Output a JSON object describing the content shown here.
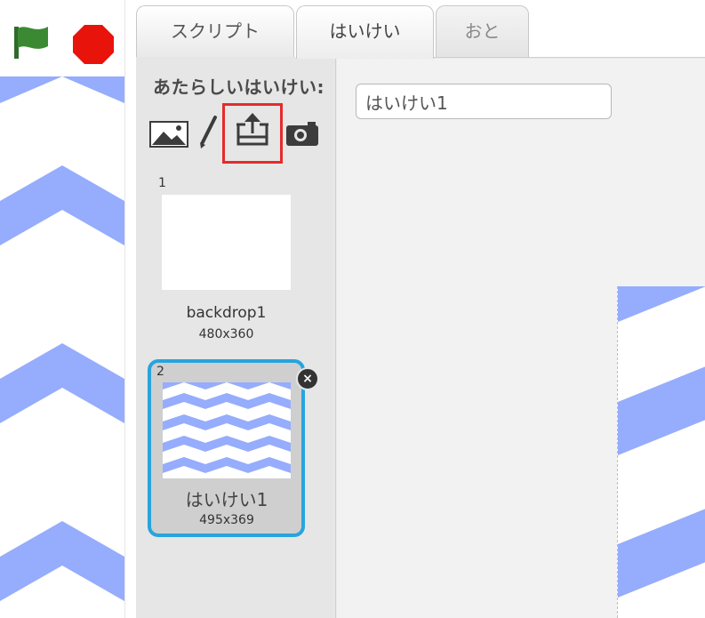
{
  "tabs": {
    "scripts": "スクリプト",
    "backdrops": "はいけい",
    "sounds": "おと"
  },
  "new_backdrop": {
    "label": "あたらしいはいけい:"
  },
  "name_field": {
    "value": "はいけい1"
  },
  "backdrops": [
    {
      "index": "1",
      "name": "backdrop1",
      "size": "480x360"
    },
    {
      "index": "2",
      "name": "はいけい1",
      "size": "495x369"
    }
  ],
  "icons": {
    "green_flag": "green-flag-icon",
    "stop": "stop-icon",
    "paint_picture": "image-icon",
    "paint_brush": "paintbrush-icon",
    "upload": "upload-icon",
    "camera": "camera-icon",
    "delete": "close-icon"
  },
  "colors": {
    "flag_green": "#2e7d32",
    "stop_red": "#e8130b",
    "chevron_blue": "#96acfc",
    "selected_border": "#27a4dd",
    "highlight_red": "#e52b2b"
  }
}
